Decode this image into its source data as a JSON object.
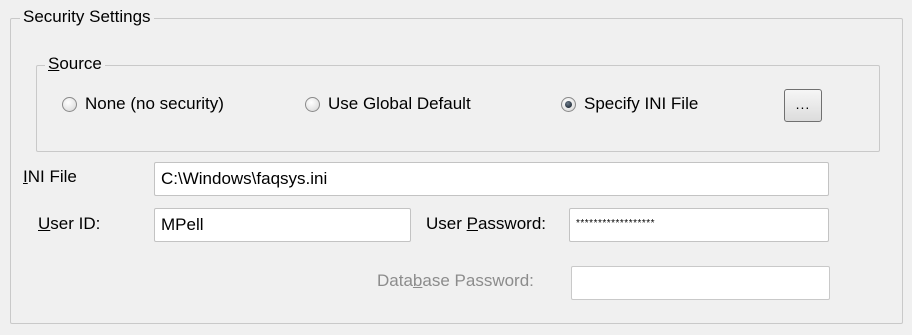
{
  "security": {
    "title": "Security Settings",
    "source": {
      "title_underline": "S",
      "title_rest": "ource",
      "options": [
        {
          "label": "None (no security)",
          "checked": false
        },
        {
          "label": "Use Global Default",
          "checked": false
        },
        {
          "label": "Specify INI File",
          "checked": true
        }
      ],
      "browse_label": "..."
    },
    "ini_file": {
      "label_underline": "I",
      "label_rest": "NI File",
      "value": "C:\\Windows\\faqsys.ini"
    },
    "user_id": {
      "label_underline": "U",
      "label_rest": "ser ID:",
      "value": "MPell"
    },
    "user_password": {
      "label_pre": "User ",
      "label_underline": "P",
      "label_rest": "assword:",
      "value": "******************"
    },
    "database_password": {
      "label_pre": "Data",
      "label_underline": "b",
      "label_rest": "ase Password:",
      "value": ""
    }
  }
}
